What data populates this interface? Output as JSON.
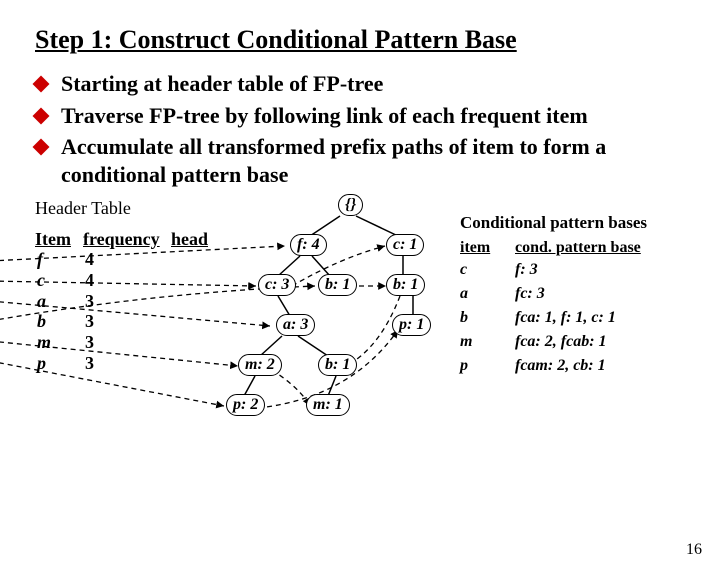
{
  "title": "Step 1: Construct Conditional Pattern Base",
  "bullets": [
    "Starting at header table of FP-tree",
    "Traverse FP-tree by following link of each frequent item",
    "Accumulate all transformed prefix paths of item to form a conditional pattern base"
  ],
  "header_table": {
    "caption": "Header Table",
    "cols": [
      "Item",
      "frequency",
      "head"
    ],
    "rows": [
      {
        "item": "f",
        "freq": "4"
      },
      {
        "item": "c",
        "freq": "4"
      },
      {
        "item": "a",
        "freq": "3"
      },
      {
        "item": "b",
        "freq": "3"
      },
      {
        "item": "m",
        "freq": "3"
      },
      {
        "item": "p",
        "freq": "3"
      }
    ]
  },
  "tree": {
    "root": "{}",
    "nodes": {
      "f4": "f: 4",
      "c1": "c: 1",
      "c3": "c: 3",
      "b1a": "b: 1",
      "b1b": "b: 1",
      "a3": "a: 3",
      "p1": "p: 1",
      "m2": "m: 2",
      "b1c": "b: 1",
      "p2": "p: 2",
      "m1": "m: 1"
    }
  },
  "cpb": {
    "title": "Conditional pattern bases",
    "head": [
      "item",
      "cond. pattern base"
    ],
    "rows": [
      {
        "item": "c",
        "val": "f: 3"
      },
      {
        "item": "a",
        "val": "fc: 3"
      },
      {
        "item": "b",
        "val": "fca: 1, f: 1, c: 1"
      },
      {
        "item": "m",
        "val": "fca: 2, fcab: 1"
      },
      {
        "item": "p",
        "val": "fcam: 2, cb: 1"
      }
    ]
  },
  "pagenum": "16"
}
